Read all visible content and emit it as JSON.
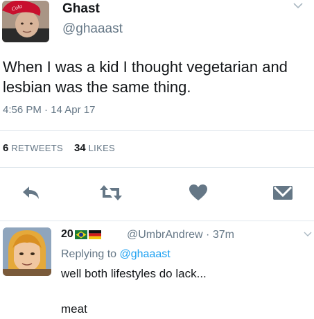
{
  "tweet": {
    "display_name": "Ghast",
    "handle": "@ghaaast",
    "text": "When I was a kid I thought vegetarian and lesbian was the same thing.",
    "timestamp": "4:56 PM · 14 Apr 17",
    "retweets_count": "6",
    "retweets_label": "RETWEETS",
    "likes_count": "34",
    "likes_label": "LIKES",
    "avatar_icon": "user-photo-with-red-cap",
    "avatar_cap_text": "Cola"
  },
  "actions": [
    {
      "name": "reply",
      "icon": "reply-arrow-icon"
    },
    {
      "name": "retweet",
      "icon": "retweet-icon"
    },
    {
      "name": "like",
      "icon": "heart-icon"
    },
    {
      "name": "message",
      "icon": "envelope-icon"
    }
  ],
  "reply": {
    "display_name_prefix": "20",
    "flags": [
      "brazil-flag-icon",
      "germany-flag-icon"
    ],
    "handle_time": "@UmbrAndrew · 37m",
    "replying_prefix": "Replying to ",
    "replying_mention": "@ghaaast",
    "text_line1": "well both lifestyles do lack...",
    "text_line2": "meat",
    "avatar_icon": "cartoon-he-man-avatar"
  },
  "colors": {
    "text_primary": "#14171a",
    "text_secondary": "#657786",
    "link": "#1da1f2",
    "divider": "#e1e8ed",
    "icon": "#657786"
  }
}
